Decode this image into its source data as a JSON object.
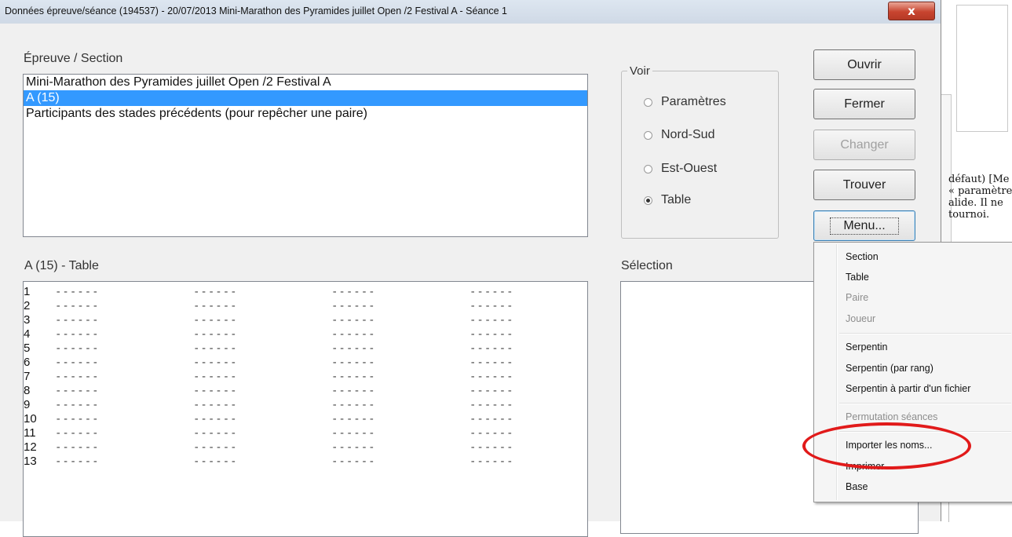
{
  "window": {
    "title": "Données épreuve/séance (194537)  -  20/07/2013  Mini-Marathon des Pyramides juillet Open /2 Festival A - Séance 1",
    "close_glyph": "x"
  },
  "epreuve": {
    "label": "Épreuve / Section",
    "items": [
      "Mini-Marathon des Pyramides juillet Open /2 Festival A",
      "A    (15)",
      "Participants des stades précédents (pour repêcher une paire)"
    ],
    "selected_index": 1
  },
  "voir": {
    "legend": "Voir",
    "options": [
      "Paramètres",
      "Nord-Sud",
      "Est-Ouest",
      "Table"
    ],
    "selected": "Table"
  },
  "buttons": {
    "ouvrir": "Ouvrir",
    "fermer": "Fermer",
    "changer": "Changer",
    "trouver": "Trouver",
    "menu": "Menu..."
  },
  "table_section": {
    "label": "A (15)  -  Table",
    "rows": [
      "1",
      "2",
      "3",
      "4",
      "5",
      "6",
      "7",
      "8",
      "9",
      "10",
      "11",
      "12",
      "13"
    ],
    "placeholder": "------"
  },
  "selection": {
    "label": "Sélection"
  },
  "background_window": {
    "lines": [
      "défaut) [Me",
      "« paramètre",
      "alide. Il ne",
      "tournoi."
    ]
  },
  "context_menu": {
    "items": [
      {
        "label": "Section",
        "enabled": true
      },
      {
        "label": "Table",
        "enabled": true
      },
      {
        "label": "Paire",
        "enabled": false
      },
      {
        "label": "Joueur",
        "enabled": false
      },
      {
        "label": "Serpentin",
        "enabled": true
      },
      {
        "label": "Serpentin (par rang)",
        "enabled": true
      },
      {
        "label": "Serpentin à partir d'un fichier",
        "enabled": true
      },
      {
        "label": "Permutation séances",
        "enabled": false
      },
      {
        "label": "Importer les noms...",
        "enabled": true
      },
      {
        "label": "Imprimer",
        "enabled": true
      },
      {
        "label": "Base",
        "enabled": true
      }
    ],
    "highlight_color": "#e11a1a"
  }
}
